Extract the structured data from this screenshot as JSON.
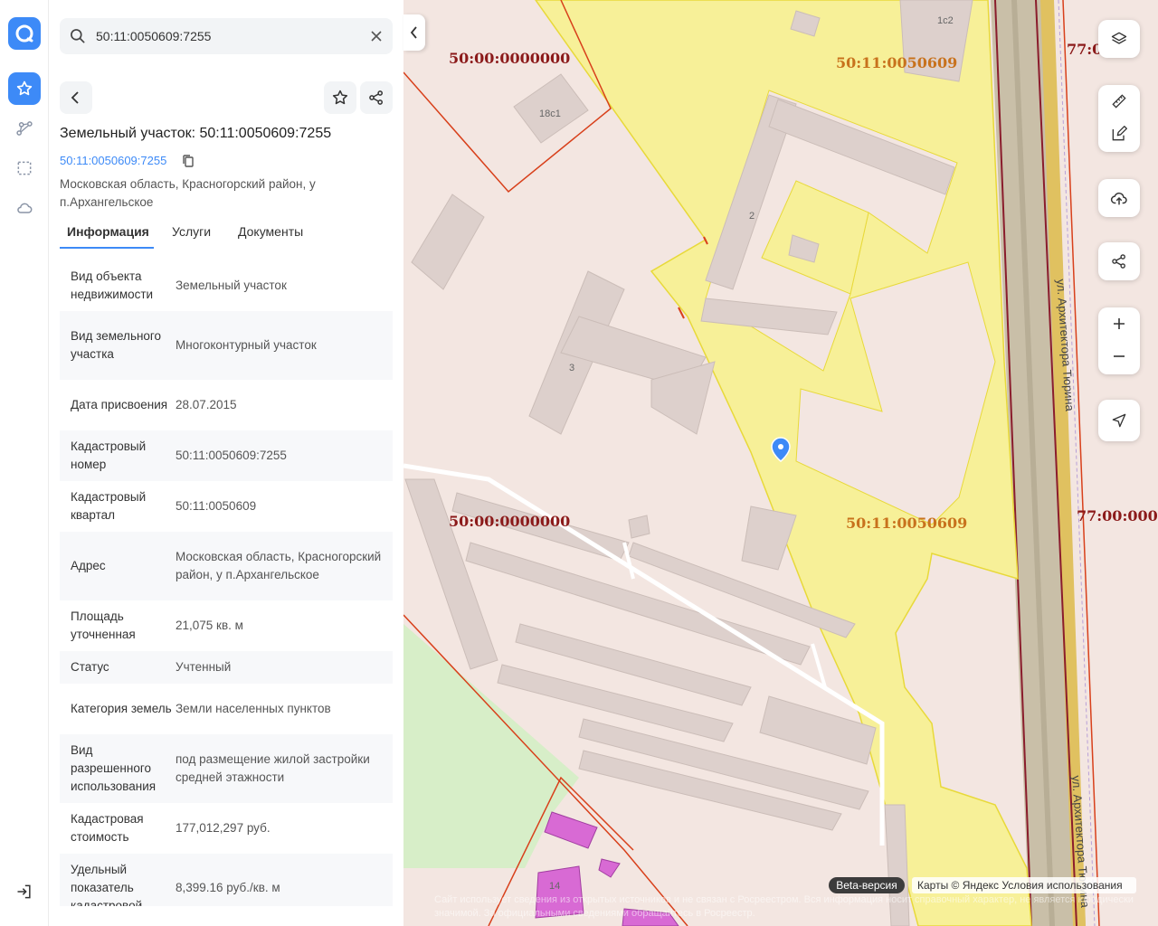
{
  "search": {
    "value": "50:11:0050609:7255"
  },
  "object": {
    "title": "Земельный участок: 50:11:0050609:7255",
    "cad_link": "50:11:0050609:7255",
    "address": "Московская область, Красногорский район, у п.Архангельское"
  },
  "tabs": [
    "Информация",
    "Услуги",
    "Документы"
  ],
  "info_rows": [
    {
      "key": "Вид объекта недвижимости",
      "value": "Земельный участок"
    },
    {
      "key": "Вид земельного участка",
      "value": "Многоконтурный участок"
    },
    {
      "key": "Дата присвоения",
      "value": "28.07.2015"
    },
    {
      "key": "Кадастровый номер",
      "value": "50:11:0050609:7255"
    },
    {
      "key": "Кадастровый квартал",
      "value": "50:11:0050609"
    },
    {
      "key": "Адрес",
      "value": "Московская область, Красногорский район, у п.Архангельское"
    },
    {
      "key": "Площадь уточненная",
      "value": "21,075 кв. м"
    },
    {
      "key": "Статус",
      "value": "Учтенный"
    },
    {
      "key": "Категория земель",
      "value": "Земли населенных пунктов"
    },
    {
      "key": "Вид разрешенного использования",
      "value": "под размещение жилой застройки средней этажности"
    },
    {
      "key": "Кадастровая стоимость",
      "value": "177,012,297 руб."
    },
    {
      "key": "Удельный показатель кадастровой",
      "value": "8,399.16 руб./кв. м"
    }
  ],
  "map": {
    "labels": {
      "quarter_top_left": "50:00:0000000",
      "quarter_mid_left": "50:00:0000000",
      "quarter_top_right": "50:11:0050609",
      "quarter_mid_right": "50:11:0050609",
      "region_top": "77:0",
      "region_mid": "77:00:000",
      "street_top": "ул. Архитектора Тюрина",
      "street_bottom": "ул. Архитектора Тюрина"
    },
    "buildings": {
      "b1": "18с1",
      "b2": "1с2",
      "b3": "2",
      "b4": "3",
      "b5": "14"
    },
    "beta": "Beta-версия",
    "attribution": "Карты © Яндекс   Условия использования",
    "disclaimer": "Сайт использует сведения из открытых источников и не связан с Росреестром. Вся информация носит справочный характер, не является юридически значимой. За официальными сведениями обращайтесь в Росреестр."
  },
  "colors": {
    "accent": "#3d8af7",
    "parcel_fill": "#f7f098",
    "parcel_border": "#e8d93a",
    "quarter_border": "#d8401b",
    "map_bg": "#f3e6e1"
  }
}
